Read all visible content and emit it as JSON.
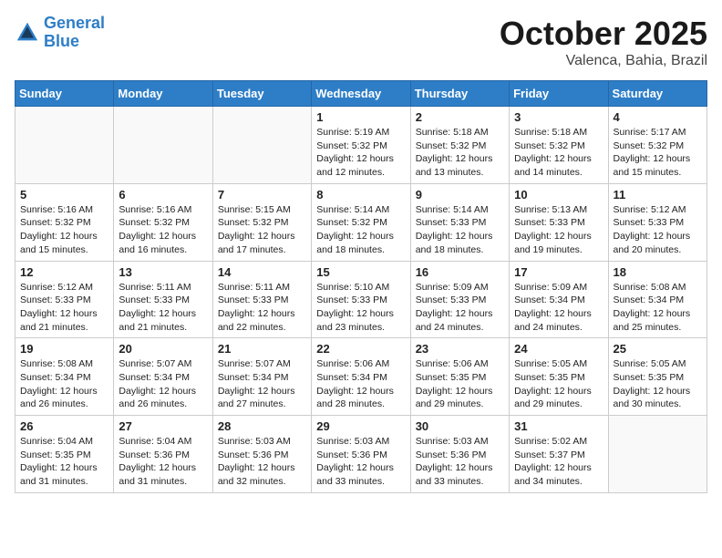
{
  "header": {
    "logo_line1": "General",
    "logo_line2": "Blue",
    "month": "October 2025",
    "location": "Valenca, Bahia, Brazil"
  },
  "weekdays": [
    "Sunday",
    "Monday",
    "Tuesday",
    "Wednesday",
    "Thursday",
    "Friday",
    "Saturday"
  ],
  "weeks": [
    [
      {
        "day": "",
        "info": ""
      },
      {
        "day": "",
        "info": ""
      },
      {
        "day": "",
        "info": ""
      },
      {
        "day": "1",
        "info": "Sunrise: 5:19 AM\nSunset: 5:32 PM\nDaylight: 12 hours and 12 minutes."
      },
      {
        "day": "2",
        "info": "Sunrise: 5:18 AM\nSunset: 5:32 PM\nDaylight: 12 hours and 13 minutes."
      },
      {
        "day": "3",
        "info": "Sunrise: 5:18 AM\nSunset: 5:32 PM\nDaylight: 12 hours and 14 minutes."
      },
      {
        "day": "4",
        "info": "Sunrise: 5:17 AM\nSunset: 5:32 PM\nDaylight: 12 hours and 15 minutes."
      }
    ],
    [
      {
        "day": "5",
        "info": "Sunrise: 5:16 AM\nSunset: 5:32 PM\nDaylight: 12 hours and 15 minutes."
      },
      {
        "day": "6",
        "info": "Sunrise: 5:16 AM\nSunset: 5:32 PM\nDaylight: 12 hours and 16 minutes."
      },
      {
        "day": "7",
        "info": "Sunrise: 5:15 AM\nSunset: 5:32 PM\nDaylight: 12 hours and 17 minutes."
      },
      {
        "day": "8",
        "info": "Sunrise: 5:14 AM\nSunset: 5:32 PM\nDaylight: 12 hours and 18 minutes."
      },
      {
        "day": "9",
        "info": "Sunrise: 5:14 AM\nSunset: 5:33 PM\nDaylight: 12 hours and 18 minutes."
      },
      {
        "day": "10",
        "info": "Sunrise: 5:13 AM\nSunset: 5:33 PM\nDaylight: 12 hours and 19 minutes."
      },
      {
        "day": "11",
        "info": "Sunrise: 5:12 AM\nSunset: 5:33 PM\nDaylight: 12 hours and 20 minutes."
      }
    ],
    [
      {
        "day": "12",
        "info": "Sunrise: 5:12 AM\nSunset: 5:33 PM\nDaylight: 12 hours and 21 minutes."
      },
      {
        "day": "13",
        "info": "Sunrise: 5:11 AM\nSunset: 5:33 PM\nDaylight: 12 hours and 21 minutes."
      },
      {
        "day": "14",
        "info": "Sunrise: 5:11 AM\nSunset: 5:33 PM\nDaylight: 12 hours and 22 minutes."
      },
      {
        "day": "15",
        "info": "Sunrise: 5:10 AM\nSunset: 5:33 PM\nDaylight: 12 hours and 23 minutes."
      },
      {
        "day": "16",
        "info": "Sunrise: 5:09 AM\nSunset: 5:33 PM\nDaylight: 12 hours and 24 minutes."
      },
      {
        "day": "17",
        "info": "Sunrise: 5:09 AM\nSunset: 5:34 PM\nDaylight: 12 hours and 24 minutes."
      },
      {
        "day": "18",
        "info": "Sunrise: 5:08 AM\nSunset: 5:34 PM\nDaylight: 12 hours and 25 minutes."
      }
    ],
    [
      {
        "day": "19",
        "info": "Sunrise: 5:08 AM\nSunset: 5:34 PM\nDaylight: 12 hours and 26 minutes."
      },
      {
        "day": "20",
        "info": "Sunrise: 5:07 AM\nSunset: 5:34 PM\nDaylight: 12 hours and 26 minutes."
      },
      {
        "day": "21",
        "info": "Sunrise: 5:07 AM\nSunset: 5:34 PM\nDaylight: 12 hours and 27 minutes."
      },
      {
        "day": "22",
        "info": "Sunrise: 5:06 AM\nSunset: 5:34 PM\nDaylight: 12 hours and 28 minutes."
      },
      {
        "day": "23",
        "info": "Sunrise: 5:06 AM\nSunset: 5:35 PM\nDaylight: 12 hours and 29 minutes."
      },
      {
        "day": "24",
        "info": "Sunrise: 5:05 AM\nSunset: 5:35 PM\nDaylight: 12 hours and 29 minutes."
      },
      {
        "day": "25",
        "info": "Sunrise: 5:05 AM\nSunset: 5:35 PM\nDaylight: 12 hours and 30 minutes."
      }
    ],
    [
      {
        "day": "26",
        "info": "Sunrise: 5:04 AM\nSunset: 5:35 PM\nDaylight: 12 hours and 31 minutes."
      },
      {
        "day": "27",
        "info": "Sunrise: 5:04 AM\nSunset: 5:36 PM\nDaylight: 12 hours and 31 minutes."
      },
      {
        "day": "28",
        "info": "Sunrise: 5:03 AM\nSunset: 5:36 PM\nDaylight: 12 hours and 32 minutes."
      },
      {
        "day": "29",
        "info": "Sunrise: 5:03 AM\nSunset: 5:36 PM\nDaylight: 12 hours and 33 minutes."
      },
      {
        "day": "30",
        "info": "Sunrise: 5:03 AM\nSunset: 5:36 PM\nDaylight: 12 hours and 33 minutes."
      },
      {
        "day": "31",
        "info": "Sunrise: 5:02 AM\nSunset: 5:37 PM\nDaylight: 12 hours and 34 minutes."
      },
      {
        "day": "",
        "info": ""
      }
    ]
  ]
}
